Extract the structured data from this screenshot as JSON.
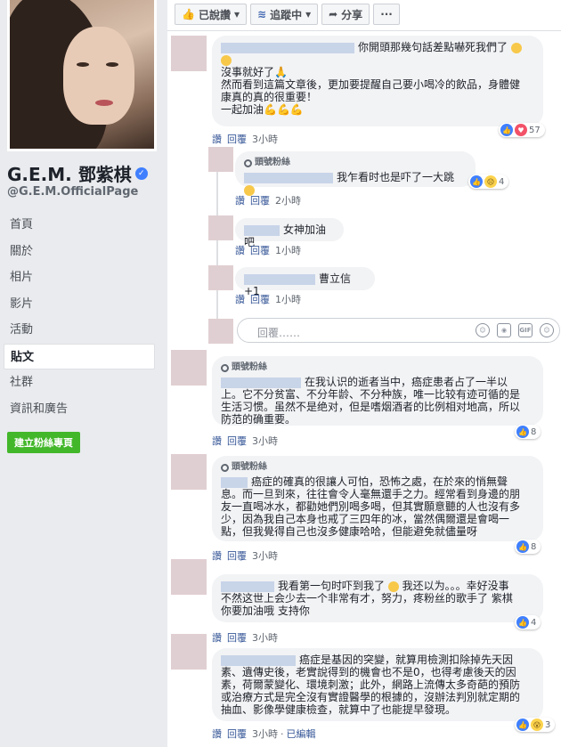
{
  "profile": {
    "name": "G.E.M. 鄧紫棋",
    "handle": "@G.E.M.OfficialPage"
  },
  "nav": [
    "首頁",
    "關於",
    "相片",
    "影片",
    "活動",
    "貼文",
    "社群",
    "資訊和廣告"
  ],
  "create_button": "建立粉絲專頁",
  "actions": {
    "liked": "已說讚",
    "following": "追蹤中",
    "share": "分享",
    "more": "···"
  },
  "fan_badge": "頭號粉絲",
  "reply_placeholder": "回覆……",
  "comments": [
    {
      "lines": [
        "你開頭那幾句話差點嚇死我們了",
        "沒事就好了",
        "然而看到這篇文章後，更加要提醒自己要小喝冷的飲品，身體健",
        "康真的真的很重要！",
        "一起加油"
      ],
      "actions": [
        "讚",
        "回覆"
      ],
      "time": "3小時",
      "reaction_count": "57"
    },
    {
      "badge": true,
      "text": "我乍看时也是吓了一大跳",
      "actions": [
        "讚",
        "回覆"
      ],
      "time": "2小時",
      "reaction_count": "4"
    },
    {
      "text": "女神加油吧",
      "actions": [
        "讚",
        "回覆"
      ],
      "time": "1小時"
    },
    {
      "text": "曹立信 +1",
      "actions": [
        "讚",
        "回覆"
      ],
      "time": "1小時"
    },
    {
      "badge": true,
      "lines": [
        "在我认识的逝者当中，癌症患者占了一半以",
        "上。它不分贫富、不分年龄、不分种族，唯一比较有迹可循的是",
        "生活习惯。虽然不是绝对，但是嗜烟酒者的比例相对地高，所以",
        "防范的确重要。"
      ],
      "actions": [
        "讚",
        "回覆"
      ],
      "time": "3小時",
      "reaction_count": "8"
    },
    {
      "badge": true,
      "lines": [
        "癌症的確真的很讓人可怕，恐怖之處，在於來的悄無聲",
        "息。而一旦到來，往往會令人毫無還手之力。經常看到身邊的朋",
        "友一直喝冰水，都勸她們別喝多喝，但其實願意聽的人也沒有多",
        "少，因為我自己本身也戒了三四年的冰，當然偶爾還是會喝一",
        "點，但我覺得自己也沒多健康哈哈，但能避免就儘量呀"
      ],
      "actions": [
        "讚",
        "回覆"
      ],
      "time": "3小時",
      "reaction_count": "8"
    },
    {
      "lines": [
        "我看第一句时吓到我了",
        "我还以为。。。幸好没事",
        "不然这世上会少去一个非常有才，努力，疼粉丝的歌手了 紫棋",
        "你要加油哦 支持你"
      ],
      "actions": [
        "讚",
        "回覆"
      ],
      "time": "3小時",
      "reaction_count": "4"
    },
    {
      "lines": [
        "癌症是基因的突變，就算用檢測扣除掉先天因",
        "素、遺傳史後，老實說得到的機會也不是0，也得考慮後天的因",
        "素，荷爾蒙變化、環境刺激；此外，網路上流傳太多奇葩的預防",
        "或治療方式是完全沒有實證醫學的根據的，沒辦法判別就定期的",
        "抽血、影像學健康檢查，就算中了也能提早發現。"
      ],
      "actions": [
        "讚",
        "回覆"
      ],
      "time": "3小時",
      "edited": "已編輯",
      "reaction_count": "3"
    }
  ]
}
